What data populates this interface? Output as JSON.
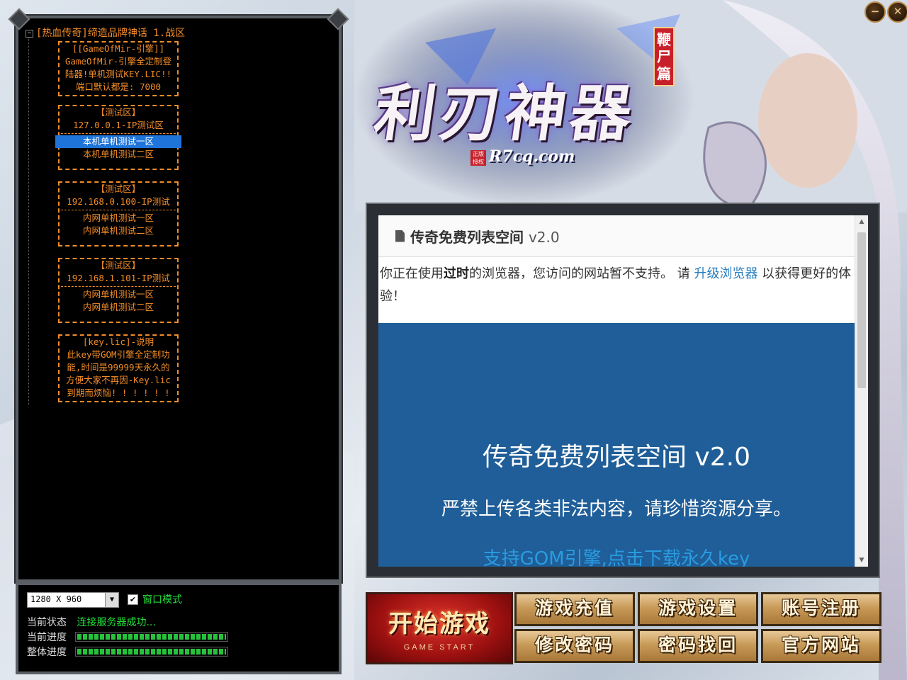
{
  "window_controls": {
    "minimize_label": "−",
    "close_label": "✕"
  },
  "tree": {
    "root_expander": "−",
    "root_label": "[热血传奇]缔造品牌神话 1.战区",
    "groups": [
      {
        "lines": [
          "[[GameOfMir-引擎]]",
          "GameOfMir-引擎全定制登",
          "陆器!单机测试KEY.LIC!!",
          "端口默认都是: 7000"
        ]
      },
      {
        "header": "【测试区】",
        "title": "127.0.0.1-IP测试区",
        "items": [
          "本机单机测试一区",
          "本机单机测试二区"
        ]
      },
      {
        "header": "【测试区】",
        "title": "192.168.0.100-IP测试",
        "items": [
          "内网单机测试一区",
          "内网单机测试二区"
        ]
      },
      {
        "header": "【测试区】",
        "title": "192.168.1.101-IP测试",
        "items": [
          "内网单机测试一区",
          "内网单机测试二区"
        ]
      },
      {
        "header": "[key.lic]-说明",
        "lines": [
          "此key带GOM引擎全定制功",
          "能,时间是99999天永久的",
          "方便大家不再因-Key.lic",
          "到期而烦恼! ! ! ! ! !"
        ]
      }
    ]
  },
  "status": {
    "resolution": "1280 X 960",
    "window_mode_label": "窗口模式",
    "window_mode_checked": true,
    "state_label": "当前状态",
    "state_text": "连接服务器成功...",
    "current_progress_label": "当前进度",
    "current_progress": 1.0,
    "overall_progress_label": "整体进度",
    "overall_progress": 1.0
  },
  "banner": {
    "title": "利刃神器",
    "subtitle": "鞭尸篇",
    "site": "R7cq.com",
    "badge": "正版授权"
  },
  "browser": {
    "site_title": "传奇免费列表空间",
    "site_version": "v2.0",
    "outdated_prefix": "你正在使用",
    "outdated_bold": "过时",
    "outdated_middle": "的浏览器，您访问的网站暂不支持。 请 ",
    "upgrade_link": "升级浏览器",
    "outdated_suffix": " 以获得更好的体验！",
    "hero_title": "传奇免费列表空间 v2.0",
    "hero_notice": "严禁上传各类非法内容，请珍惜资源分享。",
    "hero_link": "支持GOM引擎,点击下载永久key"
  },
  "buttons": {
    "start": "开始游戏",
    "start_sub": "GAME START",
    "recharge": "游戏充值",
    "settings": "游戏设置",
    "register": "账号注册",
    "change_password": "修改密码",
    "recover_password": "密码找回",
    "official_site": "官方网站"
  },
  "colors": {
    "tree_text": "#f28c28",
    "status_green": "#22e03a",
    "hero_blue": "#1f5e98",
    "selected": "#1e74d8"
  }
}
